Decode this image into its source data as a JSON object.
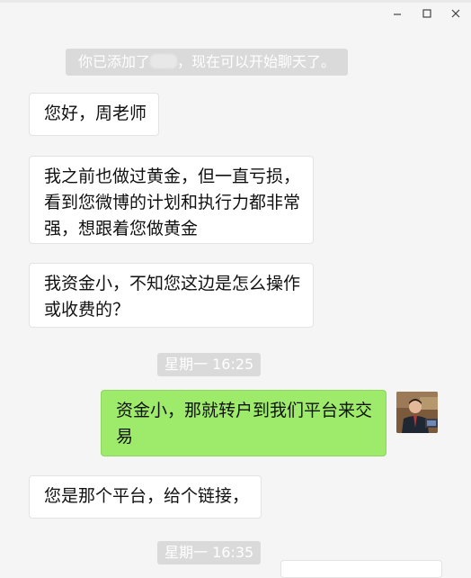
{
  "window": {
    "minimize_icon": "minimize-icon",
    "maximize_icon": "maximize-icon",
    "close_icon": "close-icon"
  },
  "system_message": {
    "prefix": "你已添加了",
    "suffix": "，现在可以开始聊天了。"
  },
  "messages": [
    {
      "text": "您好，周老师"
    },
    {
      "line1": "我之前也做过黄金，但一直亏损，",
      "line2": "看到您微博的计划和执行力都非常",
      "line3": "强，想跟着您做黄金"
    },
    {
      "line1": "我资金小，不知您这边是怎么操作",
      "line2": "或收费的？"
    },
    {
      "line1": "资金小，那就转户到我们平台来交",
      "line2": "易"
    },
    {
      "text": "您是那个平台，给个链接，"
    }
  ],
  "timestamps": [
    "星期一 16:25",
    "星期一 16:35"
  ],
  "colors": {
    "background": "#f5f5f5",
    "incoming_bubble": "#ffffff",
    "outgoing_bubble": "#9eea6a",
    "chip": "#dadada"
  }
}
